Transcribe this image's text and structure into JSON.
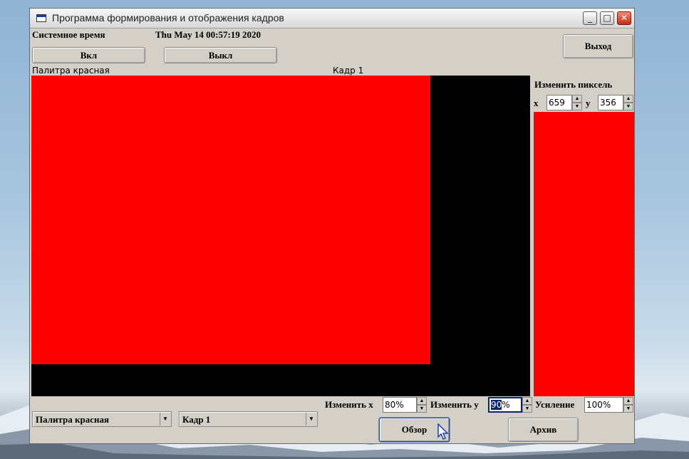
{
  "window": {
    "title": "Программа формирования и отображения кадров",
    "minimize_glyph": "_",
    "maximize_glyph": "□",
    "close_glyph": "✕"
  },
  "header": {
    "system_time_label": "Системное время",
    "system_time_value": "Thu May 14 00:57:19 2020",
    "on_button": "Вкл",
    "off_button": "Выкл",
    "exit_button": "Выход"
  },
  "display": {
    "palette_caption": "Палитра красная",
    "frame_caption": "Кадр 1"
  },
  "pixel_panel": {
    "title": "Изменить пиксель",
    "x_label": "x",
    "x_value": "659",
    "y_label": "y",
    "y_value": "356"
  },
  "bottom": {
    "change_x_label": "Изменить x",
    "change_x_value": "80%",
    "change_y_label": "Изменить y",
    "change_y_selected": "90",
    "change_y_rest": "%",
    "gain_label": "Усиление",
    "gain_value": "100%",
    "palette_select": "Палитра красная",
    "frame_select": "Кадр 1",
    "browse_button": "Обзор",
    "archive_button": "Архив"
  },
  "colors": {
    "accent_red": "#ff0000",
    "selection": "#0a246a"
  }
}
